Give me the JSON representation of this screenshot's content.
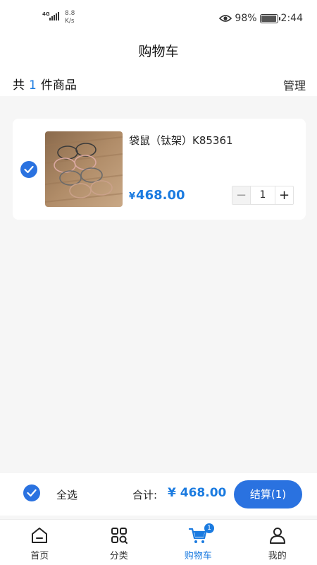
{
  "status_bar": {
    "network": "4G",
    "speed_value": "8.8",
    "speed_unit": "K/s",
    "battery": "98%",
    "battery_level": 0.98,
    "time": "2:44",
    "icons": [
      "signal-icon",
      "eye-icon",
      "battery-icon"
    ]
  },
  "header": {
    "title": "购物车"
  },
  "cart_summary": {
    "prefix": "共",
    "count": "1",
    "suffix": "件商品",
    "manage_label": "管理"
  },
  "items": [
    {
      "name": "袋鼠（钛架）K85361",
      "currency": "¥",
      "price": "468.00",
      "quantity": "1",
      "minus": "−",
      "plus": "+",
      "checked": true
    }
  ],
  "checkout": {
    "select_all_label": "全选",
    "total_label": "合计:",
    "total_value": "¥ 468.00",
    "settle_label": "结算(1)"
  },
  "tabs": [
    {
      "label": "首页",
      "icon": "home-icon"
    },
    {
      "label": "分类",
      "icon": "category-icon"
    },
    {
      "label": "购物车",
      "icon": "cart-icon",
      "badge": "1",
      "active": true
    },
    {
      "label": "我的",
      "icon": "profile-icon"
    }
  ],
  "colors": {
    "accent": "#1b7be0",
    "check": "#2a72e0",
    "background": "#f6f6f6"
  }
}
